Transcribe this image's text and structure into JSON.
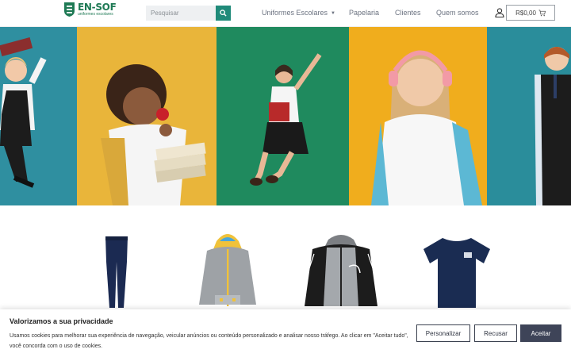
{
  "header": {
    "logo_name": "EN-SOF",
    "logo_sub": "uniformes escolares",
    "search_placeholder": "Pesquisar",
    "nav": [
      {
        "label": "Uniformes Escolares"
      },
      {
        "label": "Papelaria"
      },
      {
        "label": "Clientes"
      },
      {
        "label": "Quem somos"
      }
    ],
    "cart_total": "R$0,00"
  },
  "colors": {
    "brand_green": "#1f7a55",
    "search_button": "#1f8a79",
    "panel_teal": "#2f8fa0",
    "panel_yellow": "#e9b53a",
    "panel_green": "#1f8a5e",
    "panel_orange": "#f0ad1d",
    "panel_teal_dark": "#2a8d9b",
    "accept_button": "#3e4458"
  },
  "products": [
    {
      "icon": "navy-leggings-icon"
    },
    {
      "icon": "grey-hoodie-icon"
    },
    {
      "icon": "black-grey-jacket-icon"
    },
    {
      "icon": "navy-tshirt-icon"
    }
  ],
  "cookie": {
    "title": "Valorizamos a sua privacidade",
    "text": "Usamos cookies para melhorar sua experiência de navegação, veicular anúncios ou conteúdo personalizado e analisar nosso tráfego. Ao clicar em \"Aceitar tudo\", você concorda com o uso de cookies.",
    "customize_label": "Personalizar",
    "reject_label": "Recusar",
    "accept_label": "Aceitar"
  }
}
